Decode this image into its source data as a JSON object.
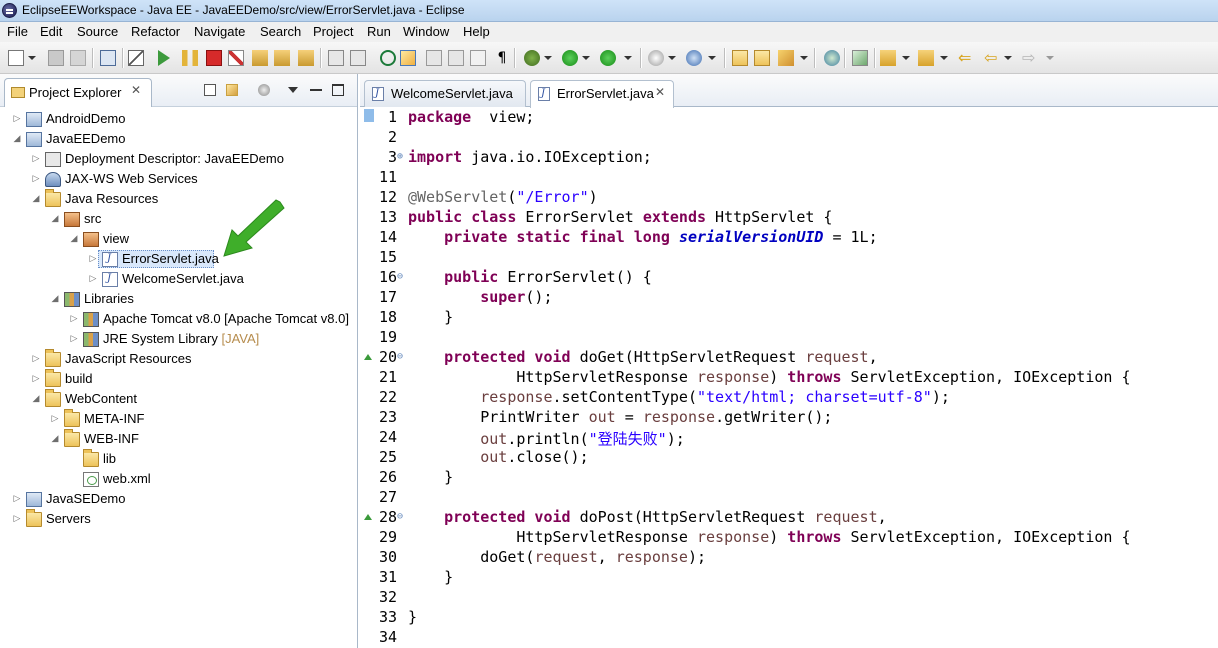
{
  "window": {
    "title": "EclipseEEWorkspace - Java EE - JavaEEDemo/src/view/ErrorServlet.java - Eclipse"
  },
  "menu": [
    "File",
    "Edit",
    "Source",
    "Refactor",
    "Navigate",
    "Search",
    "Project",
    "Run",
    "Window",
    "Help"
  ],
  "project_explorer": {
    "title": "Project Explorer",
    "close": "✕",
    "tree": [
      {
        "label": "AndroidDemo",
        "depth": 0,
        "expanded": false,
        "icon": "project"
      },
      {
        "label": "JavaEEDemo",
        "depth": 0,
        "expanded": true,
        "icon": "project"
      },
      {
        "label": "Deployment Descriptor: JavaEEDemo",
        "depth": 1,
        "expanded": false,
        "icon": "descriptor"
      },
      {
        "label": "JAX-WS Web Services",
        "depth": 1,
        "expanded": false,
        "icon": "webservice"
      },
      {
        "label": "Java Resources",
        "depth": 1,
        "expanded": true,
        "icon": "folder"
      },
      {
        "label": "src",
        "depth": 2,
        "expanded": true,
        "icon": "srcfolder"
      },
      {
        "label": "view",
        "depth": 3,
        "expanded": true,
        "icon": "package"
      },
      {
        "label": "ErrorServlet.java",
        "depth": 4,
        "expanded": false,
        "icon": "java",
        "selected": true
      },
      {
        "label": "WelcomeServlet.java",
        "depth": 4,
        "expanded": false,
        "icon": "java"
      },
      {
        "label": "Libraries",
        "depth": 2,
        "expanded": true,
        "icon": "library"
      },
      {
        "label": "Apache Tomcat v8.0 [Apache Tomcat v8.0]",
        "depth": 3,
        "expanded": false,
        "icon": "library"
      },
      {
        "label": "JRE System Library",
        "decoration": "[JAVA]",
        "depth": 3,
        "expanded": false,
        "icon": "library"
      },
      {
        "label": "JavaScript Resources",
        "depth": 1,
        "expanded": false,
        "icon": "folder"
      },
      {
        "label": "build",
        "depth": 1,
        "expanded": false,
        "icon": "folder"
      },
      {
        "label": "WebContent",
        "depth": 1,
        "expanded": true,
        "icon": "folder"
      },
      {
        "label": "META-INF",
        "depth": 2,
        "expanded": false,
        "icon": "folder"
      },
      {
        "label": "WEB-INF",
        "depth": 2,
        "expanded": true,
        "icon": "folder"
      },
      {
        "label": "lib",
        "depth": 3,
        "expanded": null,
        "icon": "folder"
      },
      {
        "label": "web.xml",
        "depth": 3,
        "expanded": null,
        "icon": "xml"
      },
      {
        "label": "JavaSEDemo",
        "depth": 0,
        "expanded": false,
        "icon": "project"
      },
      {
        "label": "Servers",
        "depth": 0,
        "expanded": false,
        "icon": "folder"
      }
    ]
  },
  "editor": {
    "tabs": [
      {
        "label": "WelcomeServlet.java",
        "active": false
      },
      {
        "label": "ErrorServlet.java",
        "active": true,
        "close": "✕"
      }
    ],
    "lines": [
      {
        "n": "1",
        "fold": "",
        "tokens": [
          [
            "kw",
            "package"
          ],
          [
            "",
            "  view;"
          ]
        ]
      },
      {
        "n": "2",
        "fold": "",
        "tokens": []
      },
      {
        "n": "3",
        "fold": "⊕",
        "tokens": [
          [
            "kw",
            "import"
          ],
          [
            "",
            " java.io.IOException;"
          ]
        ]
      },
      {
        "n": "11",
        "fold": "",
        "tokens": []
      },
      {
        "n": "12",
        "fold": "",
        "tokens": [
          [
            "ann",
            "@WebServlet"
          ],
          [
            "",
            "("
          ],
          [
            "str",
            "\"/Error\""
          ],
          [
            "",
            ")"
          ]
        ]
      },
      {
        "n": "13",
        "fold": "",
        "tokens": [
          [
            "kw",
            "public class"
          ],
          [
            "",
            " ErrorServlet "
          ],
          [
            "kw",
            "extends"
          ],
          [
            "",
            " HttpServlet {"
          ]
        ]
      },
      {
        "n": "14",
        "fold": "",
        "tokens": [
          [
            "",
            "    "
          ],
          [
            "kw",
            "private static final long"
          ],
          [
            "",
            " "
          ],
          [
            "fld",
            "serialVersionUID"
          ],
          [
            "",
            " = 1L;"
          ]
        ]
      },
      {
        "n": "15",
        "fold": "",
        "tokens": []
      },
      {
        "n": "16",
        "fold": "⊖",
        "tokens": [
          [
            "",
            "    "
          ],
          [
            "kw",
            "public"
          ],
          [
            "",
            " ErrorServlet() {"
          ]
        ]
      },
      {
        "n": "17",
        "fold": "",
        "tokens": [
          [
            "",
            "        "
          ],
          [
            "kw",
            "super"
          ],
          [
            "",
            "();"
          ]
        ]
      },
      {
        "n": "18",
        "fold": "",
        "tokens": [
          [
            "",
            "    }"
          ]
        ]
      },
      {
        "n": "19",
        "fold": "",
        "tokens": []
      },
      {
        "n": "20",
        "fold": "⊖",
        "override": true,
        "tokens": [
          [
            "",
            "    "
          ],
          [
            "kw",
            "protected void"
          ],
          [
            "",
            " doGet(HttpServletRequest "
          ],
          [
            "prm",
            "request"
          ],
          [
            "",
            ","
          ]
        ]
      },
      {
        "n": "21",
        "fold": "",
        "tokens": [
          [
            "",
            "            HttpServletResponse "
          ],
          [
            "prm",
            "response"
          ],
          [
            "",
            ") "
          ],
          [
            "kw",
            "throws"
          ],
          [
            "",
            " ServletException, IOException {"
          ]
        ]
      },
      {
        "n": "22",
        "fold": "",
        "tokens": [
          [
            "",
            "        "
          ],
          [
            "prm",
            "response"
          ],
          [
            "",
            ".setContentType("
          ],
          [
            "str",
            "\"text/html; charset=utf-8\""
          ],
          [
            "",
            ");"
          ]
        ]
      },
      {
        "n": "23",
        "fold": "",
        "tokens": [
          [
            "",
            "        PrintWriter "
          ],
          [
            "prm",
            "out"
          ],
          [
            "",
            " = "
          ],
          [
            "prm",
            "response"
          ],
          [
            "",
            ".getWriter();"
          ]
        ]
      },
      {
        "n": "24",
        "fold": "",
        "tokens": [
          [
            "",
            "        "
          ],
          [
            "prm",
            "out"
          ],
          [
            "",
            ".println("
          ],
          [
            "str",
            "\"登陆失败\""
          ],
          [
            "",
            ");"
          ]
        ]
      },
      {
        "n": "25",
        "fold": "",
        "tokens": [
          [
            "",
            "        "
          ],
          [
            "prm",
            "out"
          ],
          [
            "",
            ".close();"
          ]
        ]
      },
      {
        "n": "26",
        "fold": "",
        "tokens": [
          [
            "",
            "    }"
          ]
        ]
      },
      {
        "n": "27",
        "fold": "",
        "tokens": []
      },
      {
        "n": "28",
        "fold": "⊖",
        "override": true,
        "tokens": [
          [
            "",
            "    "
          ],
          [
            "kw",
            "protected void"
          ],
          [
            "",
            " doPost(HttpServletRequest "
          ],
          [
            "prm",
            "request"
          ],
          [
            "",
            ","
          ]
        ]
      },
      {
        "n": "29",
        "fold": "",
        "tokens": [
          [
            "",
            "            HttpServletResponse "
          ],
          [
            "prm",
            "response"
          ],
          [
            "",
            ") "
          ],
          [
            "kw",
            "throws"
          ],
          [
            "",
            " ServletException, IOException {"
          ]
        ]
      },
      {
        "n": "30",
        "fold": "",
        "tokens": [
          [
            "",
            "        doGet("
          ],
          [
            "prm",
            "request"
          ],
          [
            "",
            ", "
          ],
          [
            "prm",
            "response"
          ],
          [
            "",
            ");"
          ]
        ]
      },
      {
        "n": "31",
        "fold": "",
        "tokens": [
          [
            "",
            "    }"
          ]
        ]
      },
      {
        "n": "32",
        "fold": "",
        "tokens": []
      },
      {
        "n": "33",
        "fold": "",
        "tokens": [
          [
            "",
            "}"
          ]
        ]
      },
      {
        "n": "34",
        "fold": "",
        "tokens": []
      }
    ]
  },
  "colors": {
    "keyword": "#7f0055",
    "string": "#2a00ff",
    "annotation": "#646464",
    "field": "#0000c0",
    "param": "#6a3e3e",
    "arrow": "#3fae2a"
  }
}
